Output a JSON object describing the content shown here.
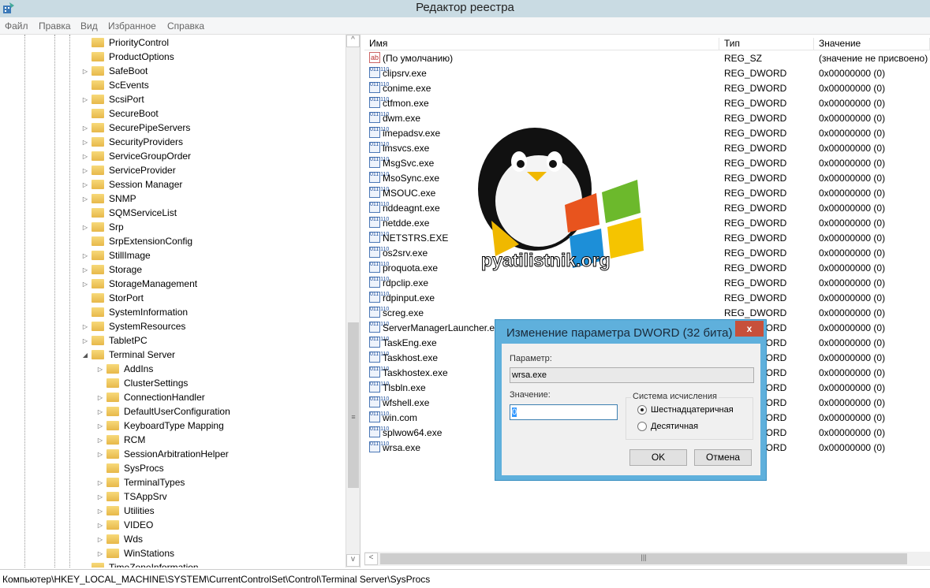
{
  "window": {
    "title": "Редактор реестра"
  },
  "menu": [
    "Файл",
    "Правка",
    "Вид",
    "Избранное",
    "Справка"
  ],
  "tree": {
    "items": [
      {
        "label": "PriorityControl",
        "level": 0,
        "exp": ""
      },
      {
        "label": "ProductOptions",
        "level": 0,
        "exp": ""
      },
      {
        "label": "SafeBoot",
        "level": 0,
        "exp": "closed"
      },
      {
        "label": "ScEvents",
        "level": 0,
        "exp": ""
      },
      {
        "label": "ScsiPort",
        "level": 0,
        "exp": "closed"
      },
      {
        "label": "SecureBoot",
        "level": 0,
        "exp": ""
      },
      {
        "label": "SecurePipeServers",
        "level": 0,
        "exp": "closed"
      },
      {
        "label": "SecurityProviders",
        "level": 0,
        "exp": "closed"
      },
      {
        "label": "ServiceGroupOrder",
        "level": 0,
        "exp": "closed"
      },
      {
        "label": "ServiceProvider",
        "level": 0,
        "exp": "closed"
      },
      {
        "label": "Session Manager",
        "level": 0,
        "exp": "closed"
      },
      {
        "label": "SNMP",
        "level": 0,
        "exp": "closed"
      },
      {
        "label": "SQMServiceList",
        "level": 0,
        "exp": ""
      },
      {
        "label": "Srp",
        "level": 0,
        "exp": "closed"
      },
      {
        "label": "SrpExtensionConfig",
        "level": 0,
        "exp": ""
      },
      {
        "label": "StillImage",
        "level": 0,
        "exp": "closed"
      },
      {
        "label": "Storage",
        "level": 0,
        "exp": "closed"
      },
      {
        "label": "StorageManagement",
        "level": 0,
        "exp": "closed"
      },
      {
        "label": "StorPort",
        "level": 0,
        "exp": ""
      },
      {
        "label": "SystemInformation",
        "level": 0,
        "exp": ""
      },
      {
        "label": "SystemResources",
        "level": 0,
        "exp": "closed"
      },
      {
        "label": "TabletPC",
        "level": 0,
        "exp": "closed"
      },
      {
        "label": "Terminal Server",
        "level": 0,
        "exp": "open"
      },
      {
        "label": "AddIns",
        "level": 1,
        "exp": "closed"
      },
      {
        "label": "ClusterSettings",
        "level": 1,
        "exp": ""
      },
      {
        "label": "ConnectionHandler",
        "level": 1,
        "exp": "closed"
      },
      {
        "label": "DefaultUserConfiguration",
        "level": 1,
        "exp": "closed"
      },
      {
        "label": "KeyboardType Mapping",
        "level": 1,
        "exp": "closed"
      },
      {
        "label": "RCM",
        "level": 1,
        "exp": "closed"
      },
      {
        "label": "SessionArbitrationHelper",
        "level": 1,
        "exp": "closed"
      },
      {
        "label": "SysProcs",
        "level": 1,
        "exp": ""
      },
      {
        "label": "TerminalTypes",
        "level": 1,
        "exp": "closed"
      },
      {
        "label": "TSAppSrv",
        "level": 1,
        "exp": "closed"
      },
      {
        "label": "Utilities",
        "level": 1,
        "exp": "closed"
      },
      {
        "label": "VIDEO",
        "level": 1,
        "exp": "closed"
      },
      {
        "label": "Wds",
        "level": 1,
        "exp": "closed"
      },
      {
        "label": "WinStations",
        "level": 1,
        "exp": "closed"
      },
      {
        "label": "TimeZoneInformation",
        "level": 0,
        "exp": ""
      }
    ]
  },
  "list": {
    "columns": [
      "Имя",
      "Тип",
      "Значение"
    ],
    "rows": [
      {
        "name": "(По умолчанию)",
        "type": "REG_SZ",
        "value": "(значение не присвоено)",
        "icon": "string"
      },
      {
        "name": "clipsrv.exe",
        "type": "REG_DWORD",
        "value": "0x00000000 (0)",
        "icon": "dword"
      },
      {
        "name": "conime.exe",
        "type": "REG_DWORD",
        "value": "0x00000000 (0)",
        "icon": "dword"
      },
      {
        "name": "ctfmon.exe",
        "type": "REG_DWORD",
        "value": "0x00000000 (0)",
        "icon": "dword"
      },
      {
        "name": "dwm.exe",
        "type": "REG_DWORD",
        "value": "0x00000000 (0)",
        "icon": "dword"
      },
      {
        "name": "imepadsv.exe",
        "type": "REG_DWORD",
        "value": "0x00000000 (0)",
        "icon": "dword"
      },
      {
        "name": "lmsvcs.exe",
        "type": "REG_DWORD",
        "value": "0x00000000 (0)",
        "icon": "dword"
      },
      {
        "name": "MsgSvc.exe",
        "type": "REG_DWORD",
        "value": "0x00000000 (0)",
        "icon": "dword"
      },
      {
        "name": "MsoSync.exe",
        "type": "REG_DWORD",
        "value": "0x00000000 (0)",
        "icon": "dword"
      },
      {
        "name": "MSOUC.exe",
        "type": "REG_DWORD",
        "value": "0x00000000 (0)",
        "icon": "dword"
      },
      {
        "name": "nddeagnt.exe",
        "type": "REG_DWORD",
        "value": "0x00000000 (0)",
        "icon": "dword"
      },
      {
        "name": "netdde.exe",
        "type": "REG_DWORD",
        "value": "0x00000000 (0)",
        "icon": "dword"
      },
      {
        "name": "NETSTRS.EXE",
        "type": "REG_DWORD",
        "value": "0x00000000 (0)",
        "icon": "dword"
      },
      {
        "name": "os2srv.exe",
        "type": "REG_DWORD",
        "value": "0x00000000 (0)",
        "icon": "dword"
      },
      {
        "name": "proquota.exe",
        "type": "REG_DWORD",
        "value": "0x00000000 (0)",
        "icon": "dword"
      },
      {
        "name": "rdpclip.exe",
        "type": "REG_DWORD",
        "value": "0x00000000 (0)",
        "icon": "dword"
      },
      {
        "name": "rdpinput.exe",
        "type": "REG_DWORD",
        "value": "0x00000000 (0)",
        "icon": "dword"
      },
      {
        "name": "screg.exe",
        "type": "REG_DWORD",
        "value": "0x00000000 (0)",
        "icon": "dword"
      },
      {
        "name": "ServerManagerLauncher.exe",
        "type": "REG_DWORD",
        "value": "0x00000000 (0)",
        "icon": "dword"
      },
      {
        "name": "TaskEng.exe",
        "type": "REG_DWORD",
        "value": "0x00000000 (0)",
        "icon": "dword"
      },
      {
        "name": "Taskhost.exe",
        "type": "REG_DWORD",
        "value": "0x00000000 (0)",
        "icon": "dword"
      },
      {
        "name": "Taskhostex.exe",
        "type": "REG_DWORD",
        "value": "0x00000000 (0)",
        "icon": "dword"
      },
      {
        "name": "Tlsbln.exe",
        "type": "REG_DWORD",
        "value": "0x00000000 (0)",
        "icon": "dword"
      },
      {
        "name": "wfshell.exe",
        "type": "REG_DWORD",
        "value": "0x00000000 (0)",
        "icon": "dword"
      },
      {
        "name": "win.com",
        "type": "REG_DWORD",
        "value": "0x00000000 (0)",
        "icon": "dword"
      },
      {
        "name": "splwow64.exe",
        "type": "REG_DWORD",
        "value": "0x00000000 (0)",
        "icon": "dword"
      },
      {
        "name": "wrsa.exe",
        "type": "REG_DWORD",
        "value": "0x00000000 (0)",
        "icon": "dword"
      }
    ]
  },
  "dialog": {
    "title": "Изменение параметра DWORD (32 бита)",
    "close": "x",
    "param_label": "Параметр:",
    "param_value": "wrsa.exe",
    "value_label": "Значение:",
    "value": "0",
    "base_label": "Система исчисления",
    "hex": "Шестнадцатеричная",
    "dec": "Десятичная",
    "selected": "hex",
    "ok": "OK",
    "cancel": "Отмена"
  },
  "watermark": {
    "text": "pyatilistnik.org"
  },
  "status": {
    "path": "Компьютер\\HKEY_LOCAL_MACHINE\\SYSTEM\\CurrentControlSet\\Control\\Terminal Server\\SysProcs"
  }
}
